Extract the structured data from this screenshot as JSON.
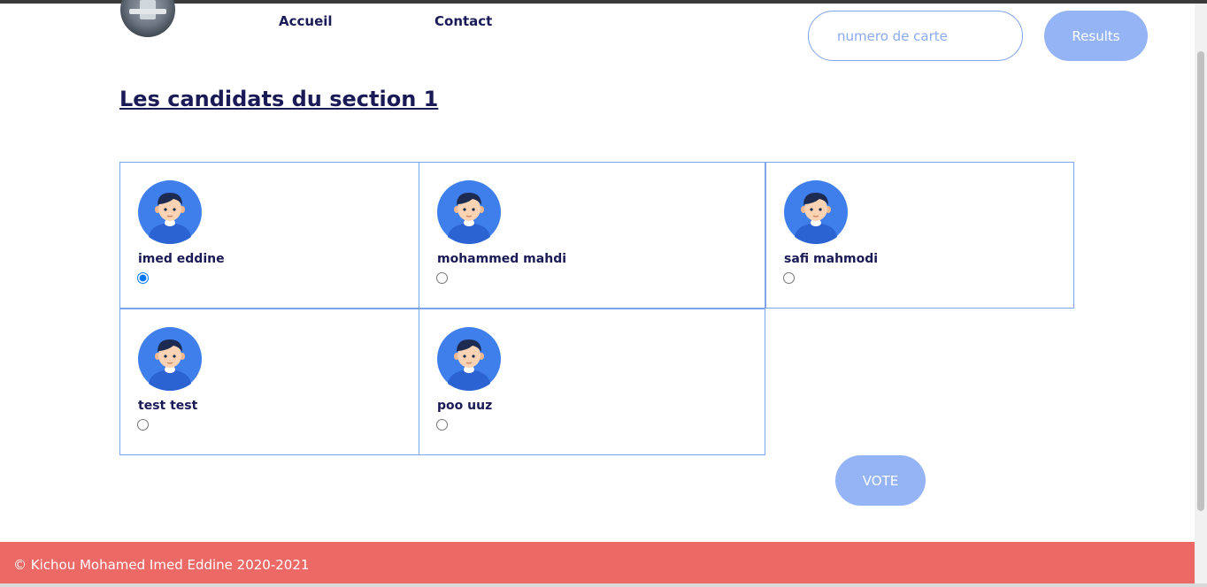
{
  "nav": {
    "home_label": "Accueil",
    "contact_label": "Contact"
  },
  "search": {
    "placeholder": "numero de carte",
    "value": ""
  },
  "results_button_label": "Results",
  "section_title": "Les candidats du section 1",
  "candidates": [
    {
      "name": "imed eddine",
      "selected": true
    },
    {
      "name": "mohammed mahdi",
      "selected": false
    },
    {
      "name": "safi mahmodi",
      "selected": false
    },
    {
      "name": "test test",
      "selected": false
    },
    {
      "name": "poo uuz",
      "selected": false
    }
  ],
  "vote_button_label": "VOTE",
  "footer_text": "© Kichou Mohamed Imed Eddine 2020-2021",
  "colors": {
    "accent": "#94b4f6",
    "border": "#7fa3ec",
    "title": "#1a1a57",
    "footer_bg": "#ed6966",
    "avatar_bg": "#3f7fec"
  },
  "icons": {
    "avatar": "user-avatar-icon",
    "logo": "university-logo"
  }
}
